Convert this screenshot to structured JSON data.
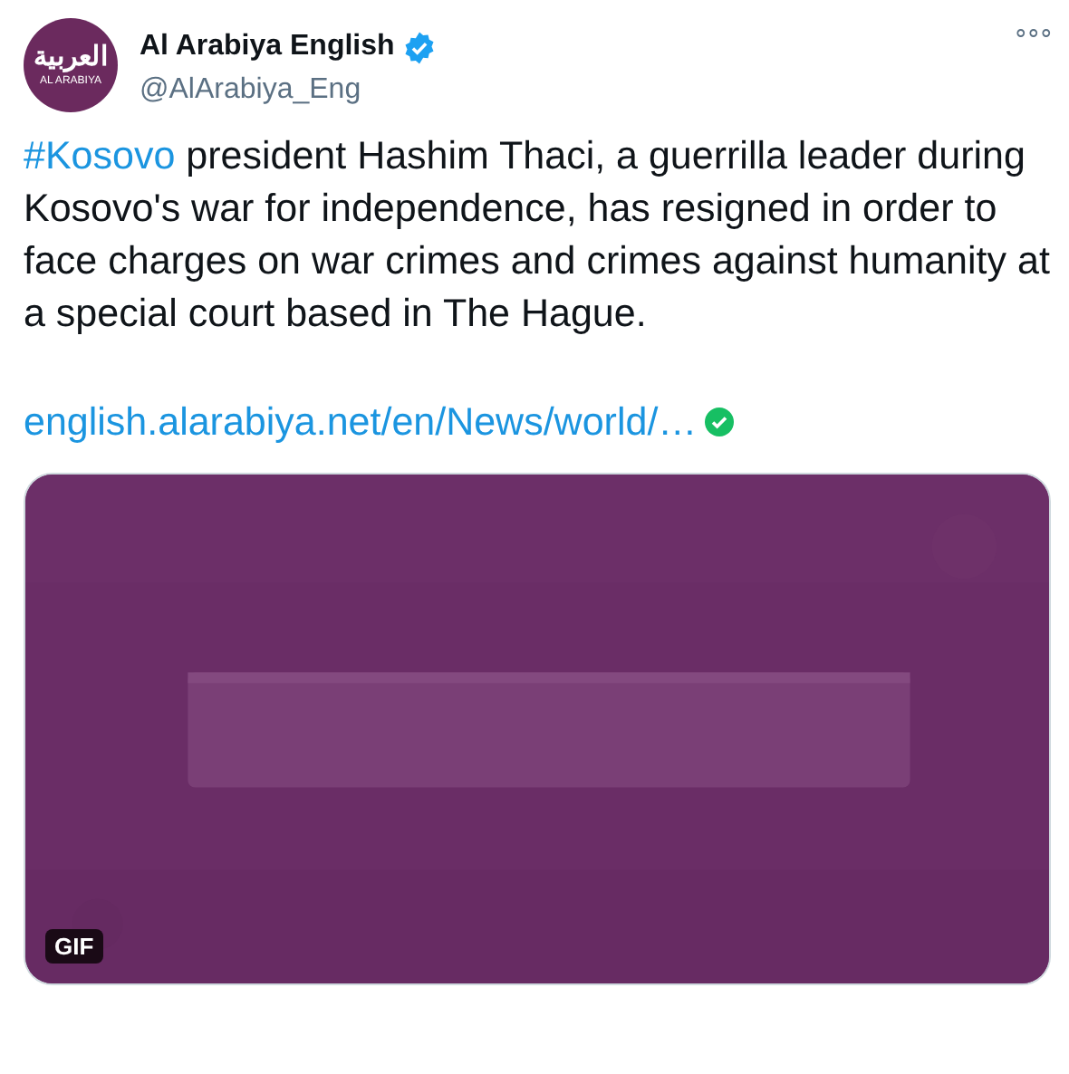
{
  "author": {
    "name": "Al Arabiya English",
    "verified": true,
    "handle": "@AlArabiya_Eng",
    "avatar": {
      "logo_text": "العربية",
      "logo_subtext": "AL ARABIYA"
    }
  },
  "more_menu": "∘∘∘",
  "tweet": {
    "hashtag": "#Kosovo",
    "text": " president Hashim Thaci, a guerrilla leader during Kosovo's war for independence, has resigned in order to face charges on war crimes and crimes against humanity at a special court based in The Hague.",
    "link": "english.alarabiya.net/en/News/world/…",
    "link_verified": true
  },
  "media": {
    "kind": "picture",
    "badge": "GIF"
  }
}
